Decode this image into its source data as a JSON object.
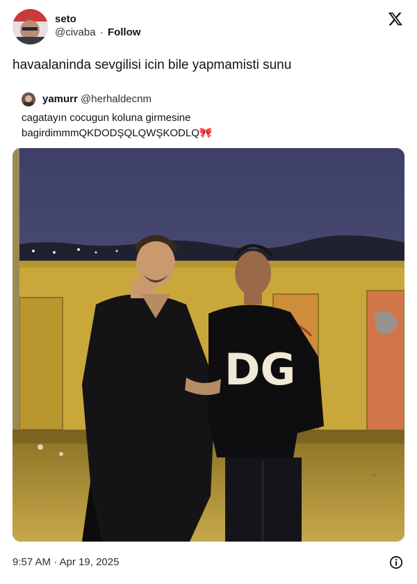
{
  "author": {
    "display_name": "seto",
    "handle": "@civaba",
    "separator": "·",
    "follow_label": "Follow"
  },
  "tweet": {
    "text": "havaalaninda sevgilisi icin bile yapmamisti sunu",
    "timestamp": "9:57 AM · Apr 19, 2025"
  },
  "quote": {
    "display_name": "yamurr",
    "handle": "@herhaldecnm",
    "text_line1": "cagatayın cocugun koluna girmesine",
    "text_line2": "bagirdimmmQKDODŞQLQWŞKODLQ",
    "emoji": "🎀"
  },
  "photo": {
    "shirt_logo": "DG"
  },
  "icons": {
    "brand": "x-logo-icon",
    "info": "info-icon"
  },
  "colors": {
    "text": "#0f1419",
    "secondary": "#2c2f33",
    "sky": "#4f5178",
    "wall": "#c9a73a"
  }
}
